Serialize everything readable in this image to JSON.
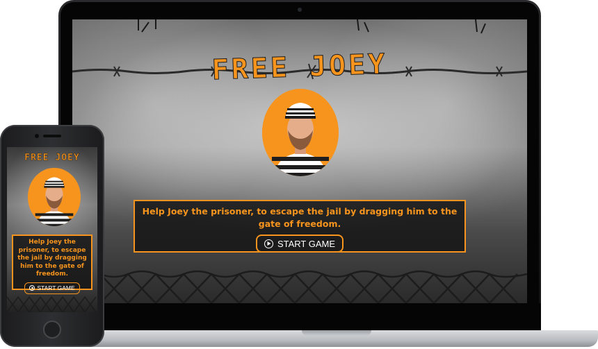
{
  "game": {
    "title": "FREE JOEY",
    "description": "Help Joey the prisoner, to escape the jail by dragging him to the gate of freedom.",
    "start_button_label": "START GAME"
  },
  "colors": {
    "accent": "#f7941d",
    "panel": "#141414",
    "button_text": "#ffffff"
  },
  "icons": {
    "start": "play-circle-icon",
    "character": "prisoner-joey-icon"
  }
}
